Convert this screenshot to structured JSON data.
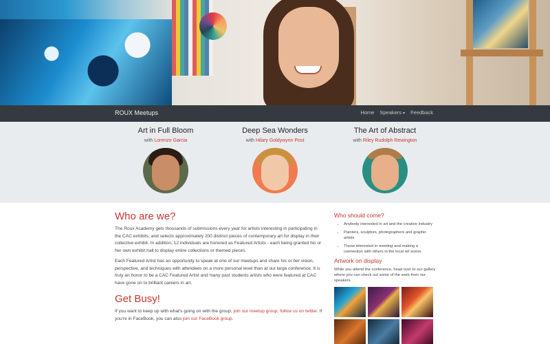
{
  "navbar": {
    "brand": "ROUX Meetups",
    "items": [
      {
        "label": "Home"
      },
      {
        "label": "Speakers",
        "has_dropdown": true
      },
      {
        "label": "Feedback"
      }
    ]
  },
  "speakers": [
    {
      "title": "Art in Full Bloom",
      "with": "with",
      "name": "Lorenzo Garcia"
    },
    {
      "title": "Deep Sea Wonders",
      "with": "with",
      "name": "Hilary Goldywynn Post"
    },
    {
      "title": "The Art of Abstract",
      "with": "with",
      "name": "Riley Rudolph Rewington"
    }
  ],
  "main": {
    "who_heading": "Who are we?",
    "who_p1": "The Roux Academy gets thousands of submissions every year for artists interesting in participating in the CAC exhibits, and selects approximately 200 distinct pieces of contemporary art for display in their collective exhibit. In addition, 12 individuals are honored as Featured Artists - each being granted his or her own exhibit hall to display entire collections or themed pieces.",
    "who_p2": "Each Featured Artist has an opportunity to speak at one of our meetups and share his or her vision, perspective, and techniques with attendees on a more personal level than at our large conference. It is truly an honor to be a CAC Featured Artist and many past students artists who were featured at CAC have gone on to brilliant careers in art.",
    "busy_heading": "Get Busy!",
    "busy_text1": "If you want to keep up with what's going on with the group, ",
    "busy_link1": "join our meetup group, follow us on twitter",
    "busy_text2": ". If you're in FaceBook, you can also ",
    "busy_link2": "join our FaceBook group."
  },
  "sidebar": {
    "who_heading": "Who should come?",
    "who_items": [
      "Anybody interested in art and the creative industry",
      "Painters, sculptors, photographers and graphic artists",
      "Those interested in meeting and making a connection with others in the local art scene."
    ],
    "art_heading": "Artwork on display",
    "art_text": "While you attend the conference, head over to our gallery where you can check out some of the work from our speakers."
  }
}
